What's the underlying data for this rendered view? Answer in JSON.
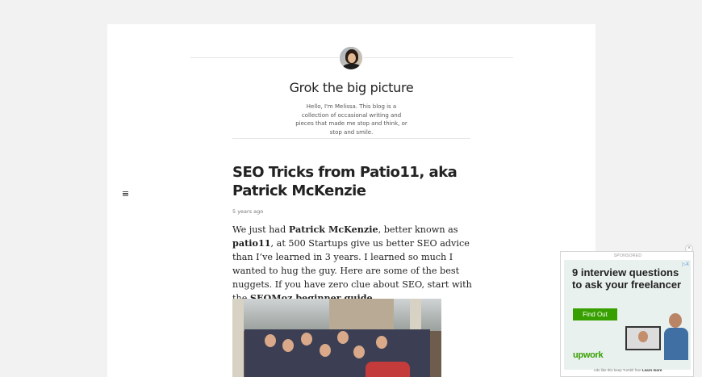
{
  "blog": {
    "title": "Grok the big picture",
    "description": "Hello, I'm Melissa. This blog is a collection of occasional writing and pieces that made me stop and think, or stop and smile."
  },
  "post": {
    "title": "SEO Tricks from Patio11, aka Patrick McKenzie",
    "date": "5 years ago",
    "body": {
      "t1": "We just had ",
      "b1": "Patrick McKenzie",
      "t2": ", better known as ",
      "b2": "patio11",
      "t3": ", at 500 Startups give us better SEO advice than I’ve learned in 3 years. I learned so much I wanted to hug the guy. Here are some of the best nuggets. If you have zero clue about SEO, start with the ",
      "b3": "SEOMoz beginner guide",
      "t4": "."
    }
  },
  "ad": {
    "label": "SPONSORED",
    "close": "×",
    "adchoices": "▷X",
    "headline": "9 interview questions to ask your freelancer",
    "cta": "Find Out",
    "brand": "upwork",
    "footer_text": "Ads like this keep Tumblr free",
    "footer_link": "Learn more"
  },
  "icons": {
    "menu": "hamburger-menu-icon",
    "avatar": "avatar"
  },
  "colors": {
    "page_bg": "#f2f2f2",
    "content_bg": "#ffffff",
    "upwork_green": "#37a000",
    "text": "#222222"
  }
}
